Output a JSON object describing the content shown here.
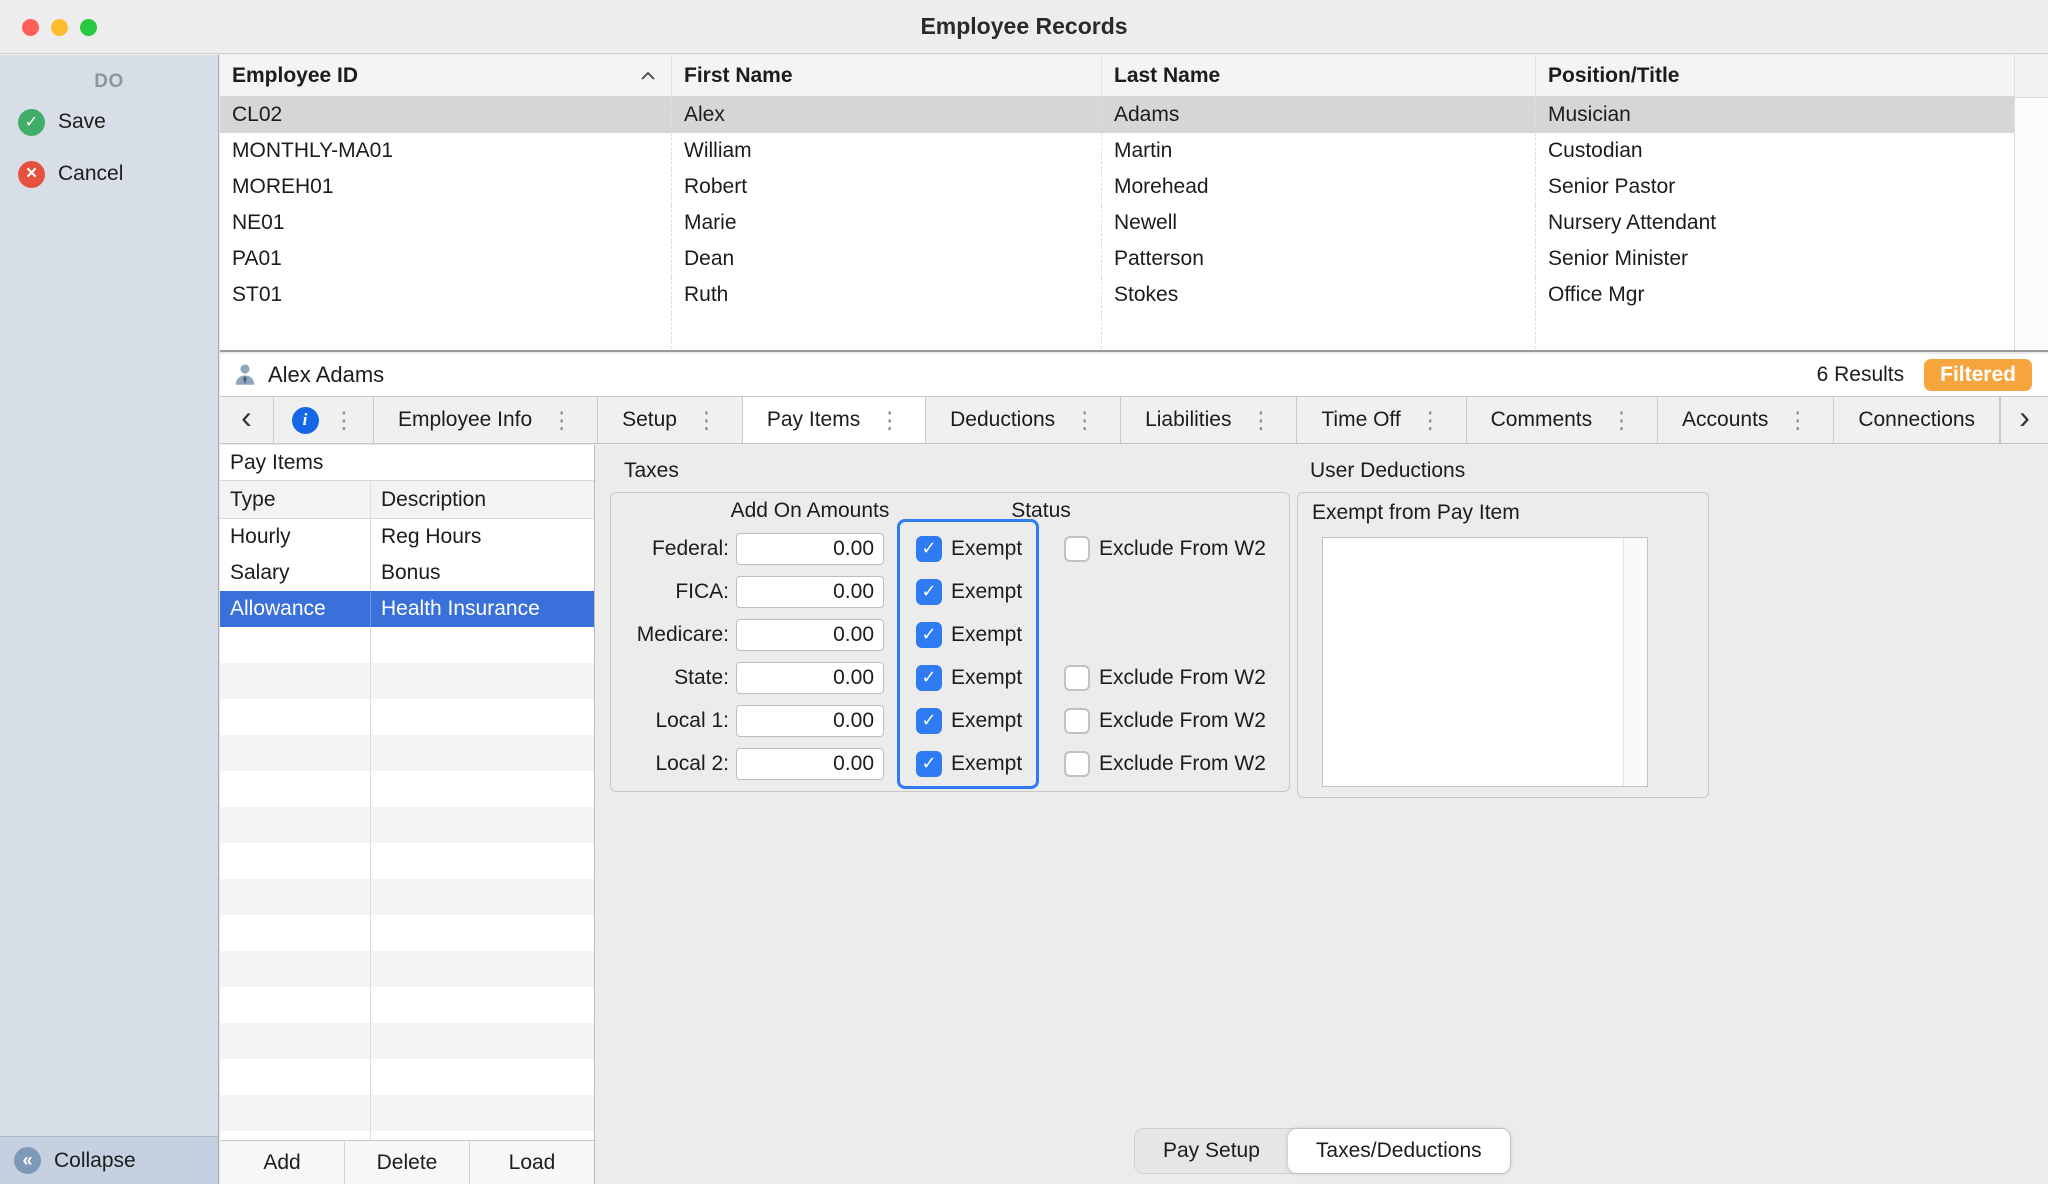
{
  "colors": {
    "accent_blue": "#2F7BF4",
    "selection_blue": "#3A70D9",
    "filtered_badge_orange": "#F6A53C",
    "save_green": "#3FAE68",
    "cancel_red": "#E4523E"
  },
  "icons": {
    "check": "✓",
    "cross": "×",
    "collapse_chevrons": "«",
    "info": "i",
    "menu_dots": "⋮",
    "chevron_left": "‹",
    "chevron_right": "›"
  },
  "window": {
    "title": "Employee Records"
  },
  "sidebar": {
    "header": "DO",
    "save_label": "Save",
    "cancel_label": "Cancel",
    "collapse_label": "Collapse"
  },
  "employee_table": {
    "columns": [
      "Employee ID",
      "First Name",
      "Last Name",
      "Position/Title"
    ],
    "sorted_column": "Employee ID",
    "sort_direction": "ascending",
    "rows": [
      {
        "employee_id": "CL02",
        "first_name": "Alex",
        "last_name": "Adams",
        "position": "Musician",
        "selected": true
      },
      {
        "employee_id": "MONTHLY-MA01",
        "first_name": "William",
        "last_name": "Martin",
        "position": "Custodian",
        "selected": false
      },
      {
        "employee_id": "MOREH01",
        "first_name": "Robert",
        "last_name": "Morehead",
        "position": "Senior Pastor",
        "selected": false
      },
      {
        "employee_id": "NE01",
        "first_name": "Marie",
        "last_name": "Newell",
        "position": "Nursery Attendant",
        "selected": false
      },
      {
        "employee_id": "PA01",
        "first_name": "Dean",
        "last_name": "Patterson",
        "position": "Senior Minister",
        "selected": false
      },
      {
        "employee_id": "ST01",
        "first_name": "Ruth",
        "last_name": "Stokes",
        "position": "Office Mgr",
        "selected": false
      }
    ]
  },
  "record_bar": {
    "name": "Alex Adams",
    "results": "6 Results",
    "filter_badge": "Filtered"
  },
  "tabs": {
    "items": [
      {
        "label": "Employee Info",
        "active": false
      },
      {
        "label": "Setup",
        "active": false
      },
      {
        "label": "Pay Items",
        "active": true
      },
      {
        "label": "Deductions",
        "active": false
      },
      {
        "label": "Liabilities",
        "active": false
      },
      {
        "label": "Time Off",
        "active": false
      },
      {
        "label": "Comments",
        "active": false
      },
      {
        "label": "Accounts",
        "active": false
      },
      {
        "label": "Connections",
        "active": false
      }
    ]
  },
  "pay_items": {
    "title": "Pay Items",
    "columns": [
      "Type",
      "Description"
    ],
    "rows": [
      {
        "type": "Hourly",
        "description": "Reg Hours",
        "selected": false
      },
      {
        "type": "Salary",
        "description": "Bonus",
        "selected": false
      },
      {
        "type": "Allowance",
        "description": "Health Insurance",
        "selected": true
      }
    ],
    "buttons": {
      "add": "Add",
      "delete": "Delete",
      "load": "Load"
    }
  },
  "taxes": {
    "title": "Taxes",
    "headers": {
      "add_on_amounts": "Add On Amounts",
      "status": "Status"
    },
    "exempt_label": "Exempt",
    "exclude_label": "Exclude From W2",
    "rows": [
      {
        "label": "Federal:",
        "amount": "0.00",
        "exempt": true,
        "has_exclude": true,
        "exclude": false
      },
      {
        "label": "FICA:",
        "amount": "0.00",
        "exempt": true,
        "has_exclude": false
      },
      {
        "label": "Medicare:",
        "amount": "0.00",
        "exempt": true,
        "has_exclude": false
      },
      {
        "label": "State:",
        "amount": "0.00",
        "exempt": true,
        "has_exclude": true,
        "exclude": false
      },
      {
        "label": "Local 1:",
        "amount": "0.00",
        "exempt": true,
        "has_exclude": true,
        "exclude": false
      },
      {
        "label": "Local 2:",
        "amount": "0.00",
        "exempt": true,
        "has_exclude": true,
        "exclude": false
      }
    ]
  },
  "user_deductions": {
    "title": "User Deductions",
    "list_label": "Exempt from Pay Item"
  },
  "bottom_tabs": {
    "items": [
      {
        "label": "Pay Setup",
        "active": false
      },
      {
        "label": "Taxes/Deductions",
        "active": true
      }
    ]
  }
}
